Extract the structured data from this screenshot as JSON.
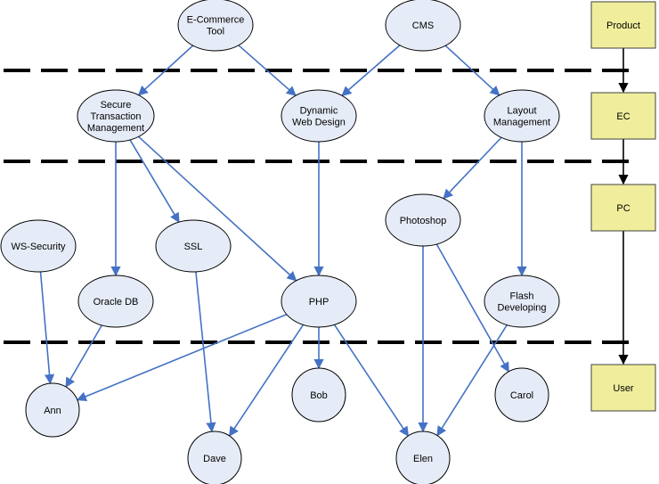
{
  "diagram": {
    "nodes": [
      {
        "id": "ecommerce",
        "lines": [
          "E-Commerce",
          "Tool"
        ]
      },
      {
        "id": "cms",
        "lines": [
          "CMS"
        ]
      },
      {
        "id": "stm",
        "lines": [
          "Secure",
          "Transaction",
          "Management"
        ]
      },
      {
        "id": "dwd",
        "lines": [
          "Dynamic",
          "Web Design"
        ]
      },
      {
        "id": "layout",
        "lines": [
          "Layout",
          "Management"
        ]
      },
      {
        "id": "wssec",
        "lines": [
          "WS-Security"
        ]
      },
      {
        "id": "ssl",
        "lines": [
          "SSL"
        ]
      },
      {
        "id": "photoshop",
        "lines": [
          "Photoshop"
        ]
      },
      {
        "id": "oracle",
        "lines": [
          "Oracle DB"
        ]
      },
      {
        "id": "php",
        "lines": [
          "PHP"
        ]
      },
      {
        "id": "flash",
        "lines": [
          "Flash",
          "Developing"
        ]
      },
      {
        "id": "ann",
        "lines": [
          "Ann"
        ]
      },
      {
        "id": "bob",
        "lines": [
          "Bob"
        ]
      },
      {
        "id": "carol",
        "lines": [
          "Carol"
        ]
      },
      {
        "id": "dave",
        "lines": [
          "Dave"
        ]
      },
      {
        "id": "elen",
        "lines": [
          "Elen"
        ]
      }
    ],
    "edges": [
      {
        "from": "ecommerce",
        "to": "stm"
      },
      {
        "from": "ecommerce",
        "to": "dwd"
      },
      {
        "from": "cms",
        "to": "dwd"
      },
      {
        "from": "cms",
        "to": "layout"
      },
      {
        "from": "stm",
        "to": "oracle"
      },
      {
        "from": "stm",
        "to": "ssl"
      },
      {
        "from": "stm",
        "to": "php"
      },
      {
        "from": "dwd",
        "to": "php"
      },
      {
        "from": "layout",
        "to": "photoshop"
      },
      {
        "from": "layout",
        "to": "flash"
      },
      {
        "from": "wssec",
        "to": "ann"
      },
      {
        "from": "oracle",
        "to": "ann"
      },
      {
        "from": "php",
        "to": "ann"
      },
      {
        "from": "ssl",
        "to": "dave"
      },
      {
        "from": "php",
        "to": "dave"
      },
      {
        "from": "php",
        "to": "bob"
      },
      {
        "from": "php",
        "to": "elen"
      },
      {
        "from": "photoshop",
        "to": "elen"
      },
      {
        "from": "photoshop",
        "to": "carol"
      },
      {
        "from": "flash",
        "to": "elen"
      }
    ],
    "levels": [
      {
        "id": "product",
        "label": "Product"
      },
      {
        "id": "ec",
        "label": "EC"
      },
      {
        "id": "pc",
        "label": "PC"
      },
      {
        "id": "user",
        "label": "User"
      }
    ],
    "colors": {
      "node_fill": "#e6ecf7",
      "level_fill": "#f0ee9c",
      "edge": "#4472c4",
      "divider": "#000000"
    }
  }
}
